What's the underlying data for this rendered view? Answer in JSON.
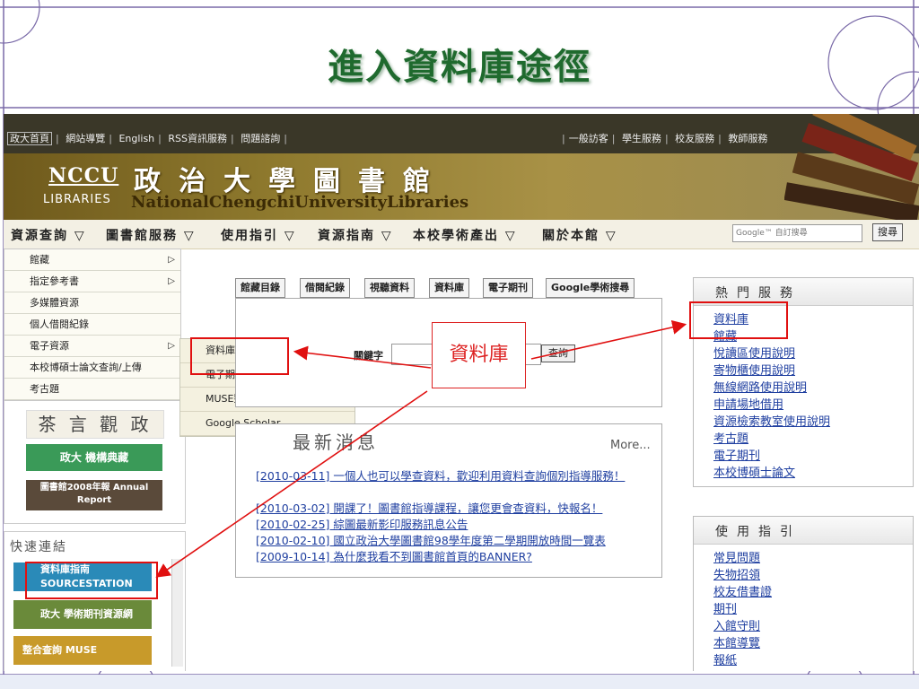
{
  "slide": {
    "title": "進入資料庫途徑"
  },
  "topbar": {
    "left_links": [
      "政大首頁",
      "網站導覽",
      "English",
      "RSS資訊服務",
      "問題諮詢"
    ],
    "right_links": [
      "一般訪客",
      "學生服務",
      "校友服務",
      "教師服務"
    ]
  },
  "banner": {
    "logo": "NCCU",
    "logo_sub": "LIBRARIES",
    "name_zh": "政治大學圖書館",
    "name_en": "NationalChengchiUniversityLibraries"
  },
  "nav": {
    "items": [
      "資源查詢",
      "圖書館服務",
      "使用指引",
      "資源指南",
      "本校學術產出",
      "關於本館"
    ],
    "search_placeholder": "Google™ 自訂搜尋",
    "search_button": "搜尋"
  },
  "menu": {
    "items": [
      "館藏",
      "指定參考書",
      "多媒體資源",
      "個人借閱紀錄",
      "電子資源",
      "本校博碩士論文查詢/上傳",
      "考古題"
    ],
    "submenu": [
      "資料庫",
      "電子期刊",
      "MUSE整合查詢系統",
      "Google Scholar"
    ]
  },
  "left": {
    "banner1": "茶 言 觀 政",
    "banner2": "政大 機構典藏",
    "banner3": "圖書館2008年報 Annual Report",
    "quick_title": "快速連結",
    "quick1": "資料庫指南 SOURCESTATION",
    "quick2": "政大 學術期刊資源網",
    "quick3": "整合查詢 MUSE"
  },
  "center": {
    "tabs": [
      "館藏目錄",
      "借閱紀錄",
      "視聽資料",
      "資料庫",
      "電子期刊",
      "Google學術搜尋"
    ],
    "keyword_label": "關鍵字",
    "query_button": "查詢",
    "callout": "資料庫",
    "news_title": "最新消息",
    "news_more": "More...",
    "news": [
      "[2010-03-11] 一個人也可以學查資料，歡迎利用資料查詢個別指導服務！",
      "[2010-03-02] 開課了！圖書館指導課程，讓您更會查資料，快報名！",
      "[2010-02-25] 綜圖最新影印服務訊息公告",
      "[2010-02-10] 國立政治大學圖書館98學年度第二學期開放時間一覽表",
      "[2009-10-14] 為什麼我看不到圖書館首頁的BANNER?"
    ]
  },
  "right": {
    "hot_title": "熱門服務",
    "hot_links": [
      "資料庫",
      "館藏",
      "悅讀區使用說明",
      "寄物櫃使用說明",
      "無線網路使用說明",
      "申請場地借用",
      "資源檢索教室使用說明",
      "考古題",
      "電子期刊",
      "本校博碩士論文"
    ],
    "guide_title": "使用指引",
    "guide_links": [
      "常見問題",
      "失物招領",
      "校友借書證",
      "期刊",
      "入館守則",
      "本館導覽",
      "報紙"
    ]
  },
  "colors": {
    "title_green": "#1f6a2e",
    "annotation_red": "#e01010",
    "link_blue": "#1f3fa0"
  }
}
